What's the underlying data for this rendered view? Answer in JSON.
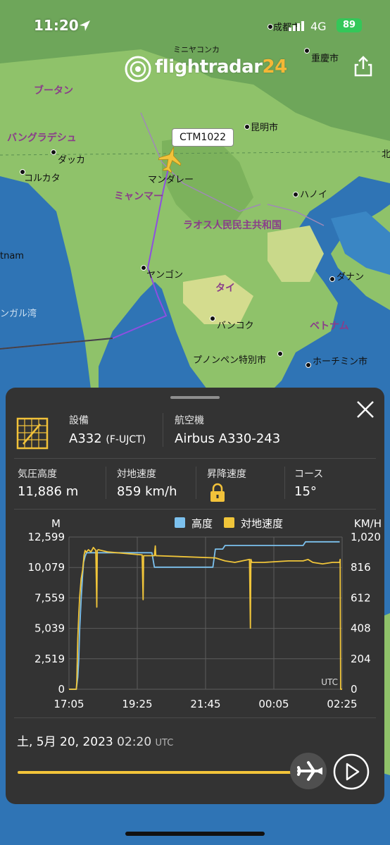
{
  "status": {
    "time": "11:20",
    "network": "4G",
    "battery": "89"
  },
  "brand": {
    "name": "flightradar",
    "suffix": "24"
  },
  "flight": {
    "callsign": "CTM1022",
    "equipment_label": "設備",
    "equipment_value": "A332",
    "registration": "(F-UJCT)",
    "aircraft_label": "航空機",
    "aircraft_value": "Airbus A330-243"
  },
  "stats": {
    "altitude_label": "気圧高度",
    "altitude_value": "11,886 m",
    "speed_label": "対地速度",
    "speed_value": "859 km/h",
    "vspeed_label": "昇降速度",
    "course_label": "コース",
    "course_value": "15°"
  },
  "map": {
    "cities": [
      {
        "name": "成都市"
      },
      {
        "name": "重慶市"
      },
      {
        "name": "ミニヤコンカ"
      },
      {
        "name": "昆明市"
      },
      {
        "name": "ダッカ"
      },
      {
        "name": "コルカタ"
      },
      {
        "name": "マンダレー"
      },
      {
        "name": "ハノイ"
      },
      {
        "name": "ヤンゴン"
      },
      {
        "name": "ダナン"
      },
      {
        "name": "バンコク"
      },
      {
        "name": "プノンペン特別市"
      },
      {
        "name": "ホーチミン市"
      }
    ],
    "countries": [
      {
        "name": "ブータン"
      },
      {
        "name": "バングラデシュ"
      },
      {
        "name": "ミャンマー"
      },
      {
        "name": "ラオス人民民主共和国"
      },
      {
        "name": "タイ"
      },
      {
        "name": "ベトナム"
      },
      {
        "name": "tnam"
      },
      {
        "name": "ンガル湾"
      },
      {
        "name": "北"
      }
    ]
  },
  "chart_data": {
    "type": "line",
    "left_unit": "M",
    "right_unit": "KM/H",
    "legend": [
      {
        "name": "高度",
        "color": "#7cc1ee"
      },
      {
        "name": "対地速度",
        "color": "#f0c53a"
      }
    ],
    "y_left_ticks": [
      "12,599",
      "10,079",
      "7,559",
      "5,039",
      "2,519",
      "0"
    ],
    "y_right_ticks": [
      "1,020",
      "816",
      "612",
      "408",
      "204",
      "0"
    ],
    "x_ticks": [
      "17:05",
      "19:25",
      "21:45",
      "00:05",
      "02:25"
    ],
    "x_minutes": [
      0,
      140,
      280,
      420,
      560
    ],
    "ylim_left": [
      0,
      12599
    ],
    "ylim_right": [
      0,
      1020
    ],
    "tz_label": "UTC",
    "series": [
      {
        "name": "高度",
        "color": "#7cc1ee",
        "x": [
          0,
          15,
          18,
          20,
          22,
          25,
          28,
          30,
          33,
          36,
          40,
          170,
          175,
          295,
          300,
          315,
          320,
          480,
          485,
          555
        ],
        "y": [
          0,
          0,
          1000,
          2500,
          5000,
          7500,
          9500,
          10500,
          11000,
          11300,
          11300,
          11300,
          10100,
          10100,
          11600,
          11600,
          11900,
          11900,
          12200,
          12200
        ]
      },
      {
        "name": "対地速度",
        "color": "#f0c53a",
        "x": [
          0,
          15,
          16,
          18,
          20,
          22,
          25,
          28,
          31,
          33,
          35,
          40,
          45,
          50,
          55,
          57,
          58,
          60,
          80,
          150,
          152,
          153,
          155,
          175,
          177,
          178,
          180,
          300,
          320,
          340,
          370,
          372,
          373,
          375,
          400,
          450,
          480,
          490,
          500,
          520,
          540,
          555,
          556,
          557,
          560
        ],
        "y": [
          0,
          0,
          50,
          340,
          500,
          620,
          740,
          800,
          900,
          930,
          918,
          935,
          920,
          950,
          930,
          550,
          930,
          935,
          920,
          900,
          600,
          895,
          895,
          895,
          960,
          895,
          895,
          880,
          860,
          850,
          870,
          410,
          870,
          850,
          850,
          860,
          860,
          870,
          850,
          840,
          850,
          850,
          870,
          0,
          0
        ]
      }
    ]
  },
  "timeline": {
    "date": "土, 5月 20, 2023",
    "time": "02:20",
    "tz": "UTC",
    "progress": 0.85
  },
  "colors": {
    "accent": "#f3c43a",
    "altitude": "#7cc1ee",
    "speed": "#f0c53a",
    "panel": "#333333"
  }
}
